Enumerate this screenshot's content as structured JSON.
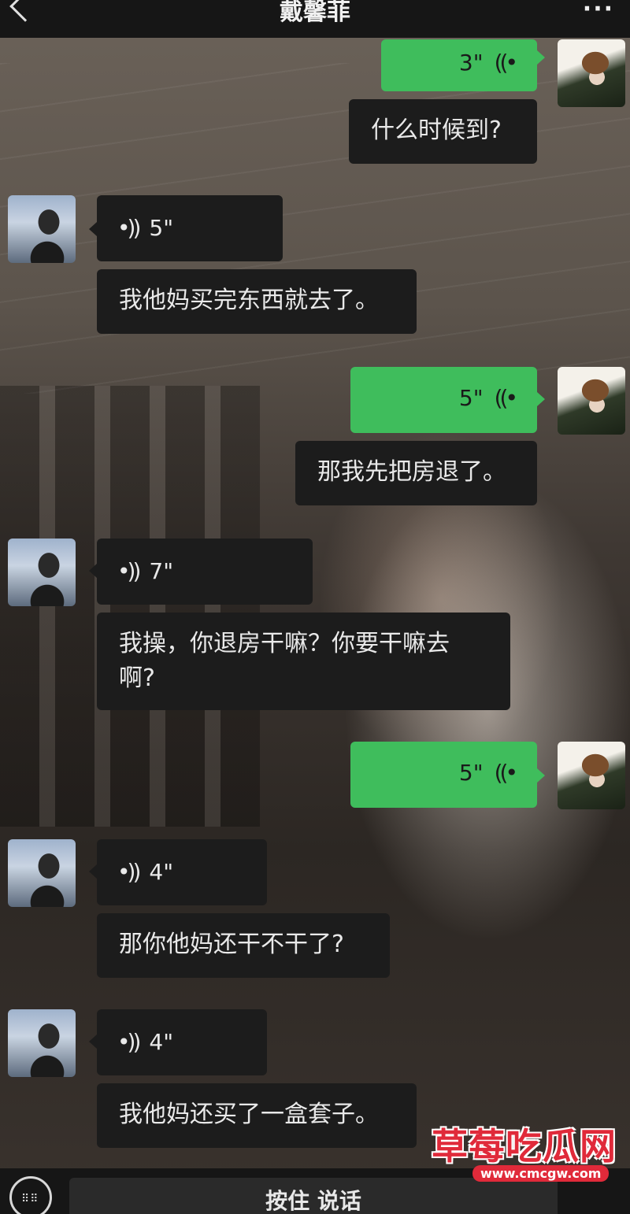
{
  "header": {
    "title": "戴馨菲",
    "back_icon": "chevron-left-icon",
    "more_label": "···"
  },
  "messages": [
    {
      "side": "right",
      "type": "voice",
      "duration": "3\""
    },
    {
      "side": "right",
      "type": "text",
      "text": "什么时候到?"
    },
    {
      "side": "left",
      "type": "voice",
      "duration": "5\""
    },
    {
      "side": "left",
      "type": "text",
      "text": "我他妈买完东西就去了。"
    },
    {
      "side": "right",
      "type": "voice",
      "duration": "5\""
    },
    {
      "side": "right",
      "type": "text",
      "text": "那我先把房退了。"
    },
    {
      "side": "left",
      "type": "voice",
      "duration": "7\""
    },
    {
      "side": "left",
      "type": "text",
      "text": "我操，你退房干嘛？你要干嘛去",
      "text2": "啊?"
    },
    {
      "side": "right",
      "type": "voice",
      "duration": "5\""
    },
    {
      "side": "left",
      "type": "voice",
      "duration": "4\""
    },
    {
      "side": "left",
      "type": "text",
      "text": "那你他妈还干不干了?"
    },
    {
      "side": "left",
      "type": "voice",
      "duration": "4\""
    },
    {
      "side": "left",
      "type": "text",
      "text": "我他妈还买了一盒套子。"
    }
  ],
  "input_bar": {
    "hold_to_talk_label": "按住 说话",
    "keyboard_icon": "keyboard-icon"
  },
  "watermark": {
    "brand": "草莓吃瓜网",
    "url": "www.cmcgw.com"
  },
  "colors": {
    "green_bubble": "#3fbd5c",
    "dark_bubble": "#1c1c1c",
    "bar": "#161616",
    "watermark_red": "#e02a3a"
  }
}
